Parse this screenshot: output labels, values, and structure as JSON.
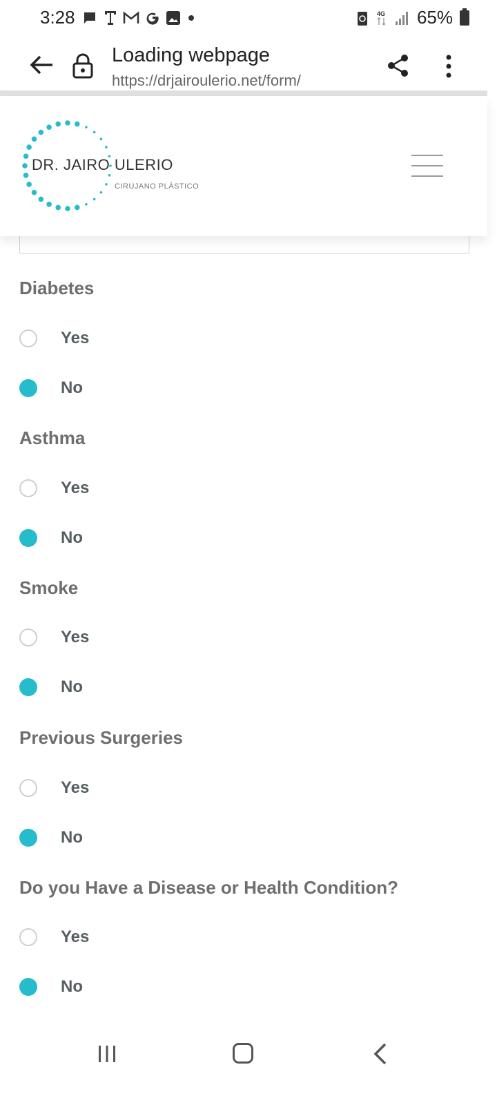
{
  "status_bar": {
    "time": "3:28",
    "battery": "65%",
    "icons": [
      "chat-icon",
      "tmobile-icon",
      "gmail-icon",
      "google-icon",
      "image-icon",
      "dot-icon",
      "battery-saver-icon",
      "4g-icon",
      "signal-icon",
      "battery-icon"
    ]
  },
  "browser": {
    "title": "Loading webpage",
    "url": "https://drjairoulerio.net/form/"
  },
  "site": {
    "logo_name": "DR. JAIRO ULERIO",
    "logo_sub": "CIRUJANO PLÁSTICO",
    "accent": "#26bccb"
  },
  "form": {
    "questions": [
      {
        "label": "Diabetes",
        "options": [
          {
            "label": "Yes",
            "checked": false
          },
          {
            "label": "No",
            "checked": true
          }
        ]
      },
      {
        "label": "Asthma",
        "options": [
          {
            "label": "Yes",
            "checked": false
          },
          {
            "label": "No",
            "checked": true
          }
        ]
      },
      {
        "label": "Smoke",
        "options": [
          {
            "label": "Yes",
            "checked": false
          },
          {
            "label": "No",
            "checked": true
          }
        ]
      },
      {
        "label": "Previous Surgeries",
        "options": [
          {
            "label": "Yes",
            "checked": false
          },
          {
            "label": "No",
            "checked": true
          }
        ]
      },
      {
        "label": "Do you Have a Disease or Health Condition?",
        "options": [
          {
            "label": "Yes",
            "checked": false
          },
          {
            "label": "No",
            "checked": true
          }
        ]
      }
    ]
  }
}
